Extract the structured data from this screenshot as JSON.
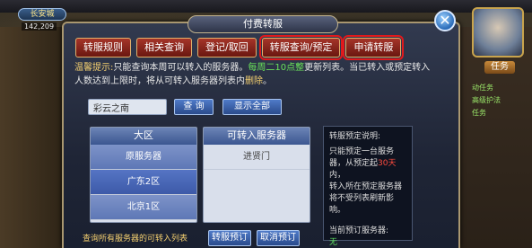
{
  "hud": {
    "city": "长安城",
    "coords": "142,209",
    "task_label": "任务",
    "side_lines": [
      "动任务",
      "高级护法",
      "任务"
    ]
  },
  "dialog": {
    "title": "付费转服",
    "close_glyph": "✕"
  },
  "tabs": [
    {
      "label": "转服规则",
      "highlighted": false
    },
    {
      "label": "相关查询",
      "highlighted": false
    },
    {
      "label": "登记/取回",
      "highlighted": false
    },
    {
      "label": "转服查询/预定",
      "highlighted": true
    },
    {
      "label": "申请转服",
      "highlighted": true
    }
  ],
  "notice": {
    "prefix": "温馨提示:",
    "part1": "只能查询本周可以转入的服务器。",
    "part2": "每周二10点整",
    "part3": "更新列表。当已转入或预定转入人数达到上限时，将从可转入服务器列表内",
    "part4": "删除",
    "part5": "。"
  },
  "search": {
    "value": "彩云之南",
    "query_label": "查 询",
    "show_all_label": "显示全部"
  },
  "region_list": {
    "header": "大区",
    "items": [
      "原服务器",
      "广东2区",
      "北京1区"
    ],
    "selected_index": 1
  },
  "server_list": {
    "header": "可转入服务器",
    "items": [
      "进贤门"
    ]
  },
  "info_panel": {
    "title": "转服预定说明:",
    "line1": "只能预定一台服务",
    "line2a": "器，从预定起",
    "days": "30天",
    "line2b": "内，",
    "line3": "转入所在预定服务器",
    "line4": "将不受列表刷新影响。",
    "current_label": "当前预订服务器:",
    "current_value": "无"
  },
  "bottom": {
    "link": "查询所有服务器的可转入列表",
    "reserve_label": "转服预订",
    "cancel_label": "取消预订"
  },
  "colors": {
    "tab_red": "#a53529",
    "highlight_outline": "#e0191c",
    "button_blue": "#4f7ac8",
    "notice_yellow": "#f5d070",
    "notice_green": "#6ae25a"
  }
}
